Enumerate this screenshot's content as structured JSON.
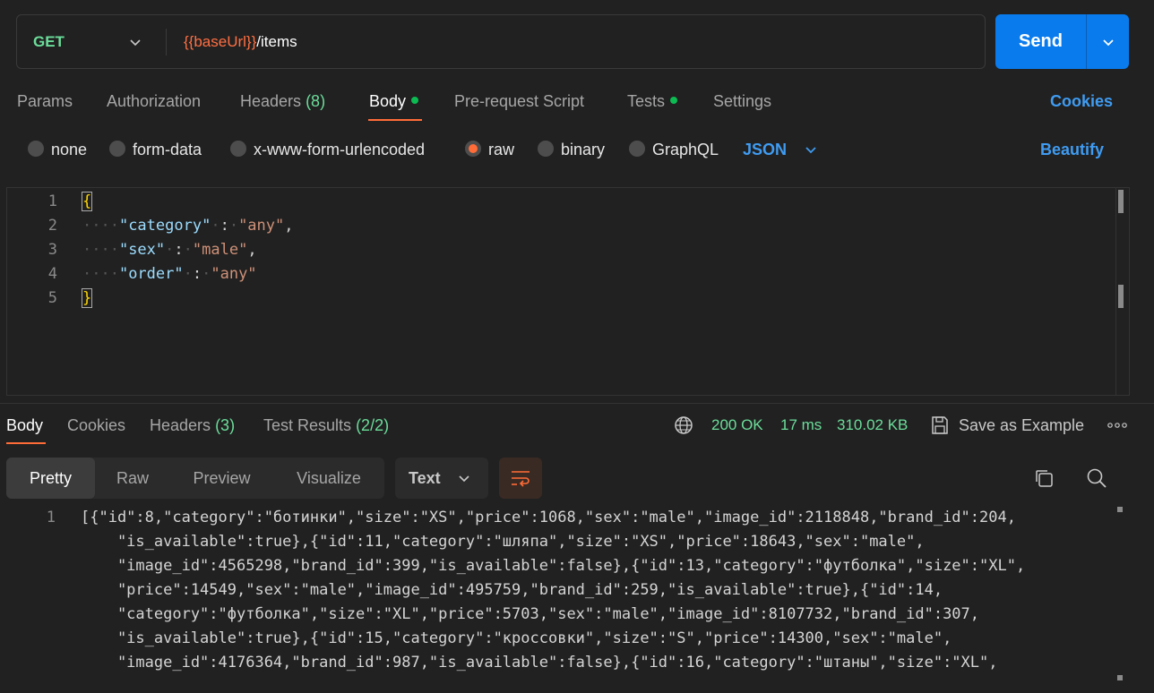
{
  "request": {
    "method": "GET",
    "url_variable": "{{baseUrl}}",
    "url_path": "/items",
    "send_label": "Send"
  },
  "request_tabs": [
    {
      "label": "Params"
    },
    {
      "label": "Authorization"
    },
    {
      "label": "Headers",
      "count": "(8)"
    },
    {
      "label": "Body",
      "active": true,
      "dot": true
    },
    {
      "label": "Pre-request Script"
    },
    {
      "label": "Tests",
      "dot": true
    },
    {
      "label": "Settings"
    }
  ],
  "cookies_label": "Cookies",
  "body_types": {
    "options": [
      "none",
      "form-data",
      "x-www-form-urlencoded",
      "raw",
      "binary",
      "GraphQL"
    ],
    "selected": "raw",
    "language": "JSON",
    "beautify_label": "Beautify"
  },
  "editor": {
    "line_numbers": [
      "1",
      "2",
      "3",
      "4",
      "5"
    ],
    "open_brace": "{",
    "close_brace": "}",
    "fields": [
      {
        "key": "\"category\"",
        "value": "\"any\"",
        "comma": ","
      },
      {
        "key": "\"sex\"",
        "value": "\"male\"",
        "comma": ","
      },
      {
        "key": "\"order\"",
        "value": "\"any\"",
        "comma": ""
      }
    ]
  },
  "response_tabs": [
    {
      "label": "Body",
      "active": true
    },
    {
      "label": "Cookies"
    },
    {
      "label": "Headers",
      "count": "(3)"
    },
    {
      "label": "Test Results",
      "count": "(2/2)"
    }
  ],
  "response_status": {
    "code": "200 OK",
    "time": "17 ms",
    "size": "310.02 KB",
    "save_label": "Save as Example",
    "more": "ooo"
  },
  "view_modes": {
    "options": [
      "Pretty",
      "Raw",
      "Preview",
      "Visualize"
    ],
    "selected": "Pretty",
    "format": "Text"
  },
  "response_body": {
    "line_number": "1",
    "lines": [
      "[{\"id\":8,\"category\":\"ботинки\",\"size\":\"XS\",\"price\":1068,\"sex\":\"male\",\"image_id\":2118848,\"brand_id\":204,",
      "    \"is_available\":true},{\"id\":11,\"category\":\"шляпа\",\"size\":\"XS\",\"price\":18643,\"sex\":\"male\",",
      "    \"image_id\":4565298,\"brand_id\":399,\"is_available\":false},{\"id\":13,\"category\":\"футболка\",\"size\":\"XL\",",
      "    \"price\":14549,\"sex\":\"male\",\"image_id\":495759,\"brand_id\":259,\"is_available\":true},{\"id\":14,",
      "    \"category\":\"футболка\",\"size\":\"XL\",\"price\":5703,\"sex\":\"male\",\"image_id\":8107732,\"brand_id\":307,",
      "    \"is_available\":true},{\"id\":15,\"category\":\"кроссовки\",\"size\":\"S\",\"price\":14300,\"sex\":\"male\",",
      "    \"image_id\":4176364,\"brand_id\":987,\"is_available\":false},{\"id\":16,\"category\":\"штаны\",\"size\":\"XL\","
    ]
  },
  "colors": {
    "accent": "#ff6c37",
    "link": "#3f9cf2",
    "success": "#6bdd9a",
    "send": "#097bed"
  }
}
